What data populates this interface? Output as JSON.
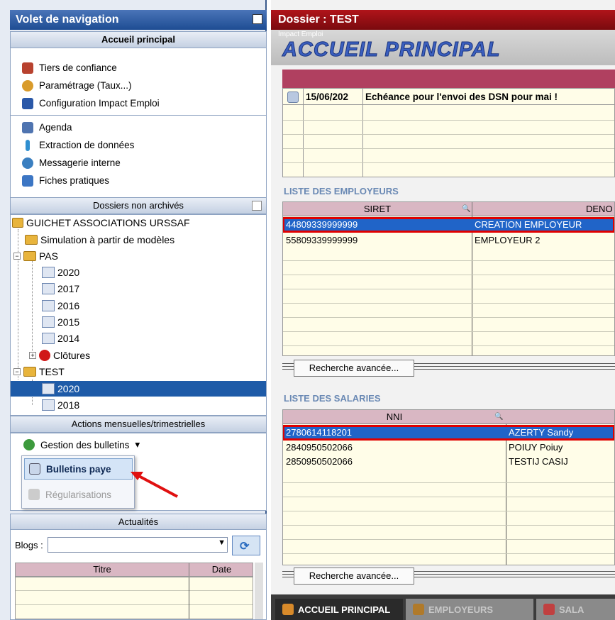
{
  "nav": {
    "title": "Volet de navigation",
    "home_header": "Accueil principal",
    "menu1": [
      "Tiers de confiance",
      "Paramétrage (Taux...)",
      "Configuration Impact Emploi"
    ],
    "menu2": [
      "Agenda",
      "Extraction de données",
      "Messagerie interne",
      "Fiches pratiques"
    ],
    "dossiers_header": "Dossiers non archivés",
    "tree": {
      "root": "GUICHET ASSOCIATIONS URSSAF",
      "simulation": "Simulation à partir de modèles",
      "pas": "PAS",
      "pas_years": [
        "2020",
        "2017",
        "2016",
        "2015",
        "2014"
      ],
      "clotures": "Clôtures",
      "test": "TEST",
      "test_years": [
        "2020",
        "2018"
      ]
    },
    "actions_header": "Actions mensuelles/trimestrielles",
    "gestion": "Gestion des bulletins",
    "popup": {
      "bulletins": "Bulletins paye",
      "regularisations": "Régularisations"
    },
    "actualites_header": "Actualités",
    "blogs_label": "Blogs :",
    "blog_cols": [
      "Titre",
      "Date"
    ]
  },
  "dossier": {
    "title": "Dossier : TEST",
    "subtitle": "Impact Emploi",
    "big_title": "ACCUEIL PRINCIPAL",
    "alert": {
      "date": "15/06/202",
      "text": "Echéance pour l'envoi des DSN pour mai !"
    }
  },
  "employeurs": {
    "title": "LISTE DES EMPLOYEURS",
    "cols": [
      "SIRET",
      "DENO"
    ],
    "rows": [
      {
        "siret": "44809339999999",
        "deno": "CREATION EMPLOYEUR"
      },
      {
        "siret": "55809339999999",
        "deno": "EMPLOYEUR 2"
      }
    ],
    "search": "Recherche avancée..."
  },
  "salaries": {
    "title": "LISTE DES SALARIES",
    "cols": [
      "NNI",
      ""
    ],
    "rows": [
      {
        "nni": "2780614118201",
        "name": "AZERTY Sandy"
      },
      {
        "nni": "2840950502066",
        "name": "POIUY Poiuy"
      },
      {
        "nni": "2850950502066",
        "name": "TESTIJ CASIJ"
      }
    ],
    "search": "Recherche avancée..."
  },
  "tabs": [
    "ACCUEIL PRINCIPAL",
    "EMPLOYEURS",
    "SALA"
  ],
  "colors": {
    "nav_blue": "#1e4d93",
    "dossier_red": "#b0141a",
    "selection": "#2064c8",
    "highlight": "#e00000"
  }
}
